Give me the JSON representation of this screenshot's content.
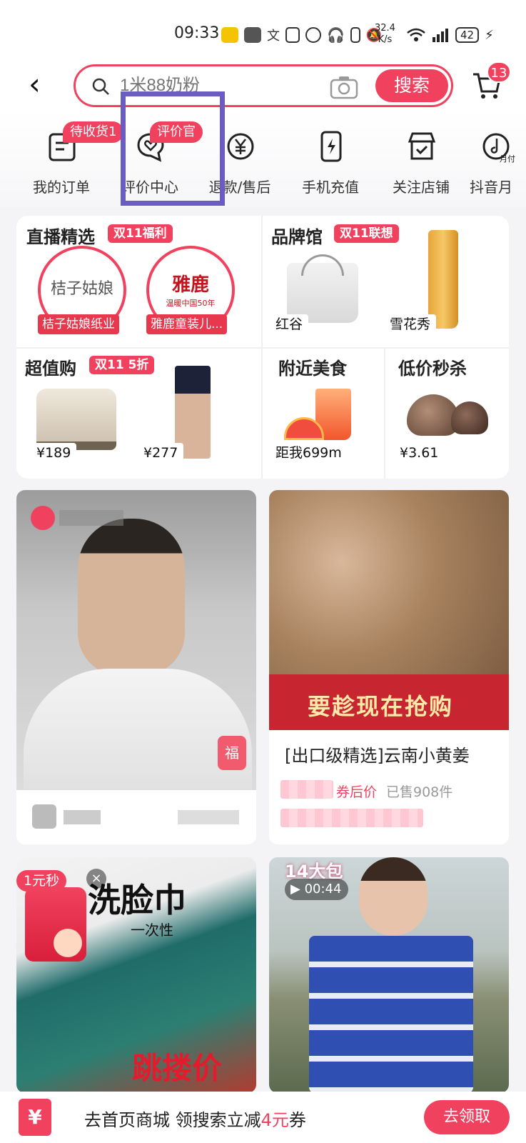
{
  "status_bar": {
    "time": "09:33",
    "net_speed_value": "32.4",
    "net_speed_unit": "K/s",
    "battery": "42"
  },
  "search": {
    "placeholder": "1米88奶粉",
    "button_label": "搜索",
    "cart_badge": "13"
  },
  "quick_nav": {
    "items": [
      {
        "label": "我的订单",
        "badge": "待收货1",
        "icon": "order-list-icon"
      },
      {
        "label": "评价中心",
        "badge": "评价官",
        "icon": "review-heart-icon"
      },
      {
        "label": "退款/售后",
        "icon": "refund-yen-icon"
      },
      {
        "label": "手机充值",
        "icon": "phone-charge-icon"
      },
      {
        "label": "关注店铺",
        "icon": "store-follow-icon"
      },
      {
        "label": "抖音月",
        "icon": "douyin-monthly-icon",
        "icon_text": "月付"
      }
    ]
  },
  "promo": {
    "live": {
      "title": "直播精选",
      "tag": "双11福利",
      "shops": [
        {
          "name": "桔子姑娘纸业",
          "logo_text": "桔子姑娘"
        },
        {
          "name": "雅鹿童装儿...",
          "logo_text": "雅鹿",
          "logo_sub": "温暖中国50年"
        }
      ]
    },
    "brand": {
      "title": "品牌馆",
      "tag": "双11联想",
      "items": [
        "红谷",
        "雪花秀"
      ]
    },
    "value": {
      "title": "超值购",
      "tag": "双11 5折",
      "prices": [
        "¥189",
        "¥277"
      ]
    },
    "food": {
      "title": "附近美食",
      "distance": "距我699m"
    },
    "flash": {
      "title": "低价秒杀",
      "price": "¥3.61"
    }
  },
  "feed": {
    "card2": {
      "banner": "要趁现在抢购",
      "title": "[出口级精选]云南小黄姜",
      "price_label": "券后价",
      "sold": "已售908件"
    },
    "card3": {
      "corner_badge": "1元秒",
      "image_text": "洗脸巾",
      "image_sub": "一次性",
      "promo_text": "跳搂价"
    },
    "card4": {
      "caption": "14大包",
      "duration": "00:44"
    }
  },
  "bottom_banner": {
    "icon": "¥",
    "text_prefix": "去首页商城 领搜索立减",
    "amount": "4元",
    "text_suffix": "券",
    "button": "去领取"
  },
  "colors": {
    "accent": "#f0425f",
    "highlight": "#6a5cc0"
  }
}
